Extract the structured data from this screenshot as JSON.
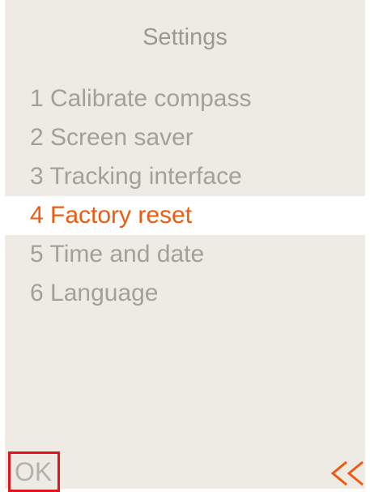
{
  "header": {
    "title": "Settings"
  },
  "menu": {
    "items": [
      {
        "label": "1 Calibrate compass",
        "selected": false
      },
      {
        "label": "2 Screen saver",
        "selected": false
      },
      {
        "label": "3 Tracking interface",
        "selected": false
      },
      {
        "label": "4 Factory reset",
        "selected": true
      },
      {
        "label": "5 Time and date",
        "selected": false
      },
      {
        "label": "6 Language",
        "selected": false
      }
    ]
  },
  "footer": {
    "ok_label": "OK",
    "back_icon": "double-chevron-left-icon"
  },
  "colors": {
    "background": "#eeebe4",
    "text_muted": "#a3a09a",
    "accent": "#f05a0f",
    "ok_border": "#e3141b"
  }
}
